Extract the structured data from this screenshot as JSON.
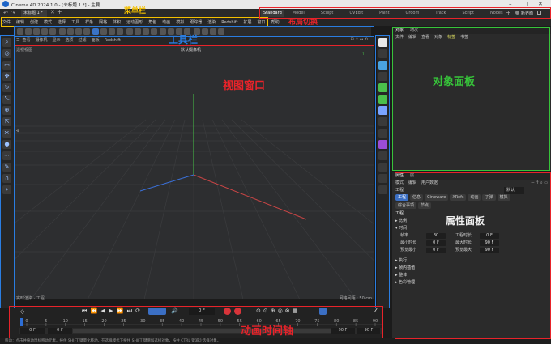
{
  "window": {
    "title": "Cinema 4D 2024.1.0 - [未标题 1 *] - 主要"
  },
  "doc_tab": {
    "label": "未标题 1 *"
  },
  "layout_tabs": [
    "Standard",
    "Model",
    "Sculpt",
    "UVEdit",
    "Paint",
    "Groom",
    "Track",
    "Script",
    "Nodes"
  ],
  "layout_new": "新界面",
  "menu": {
    "items": [
      "文件",
      "编辑",
      "创建",
      "模式",
      "选择",
      "工具",
      "样条",
      "网格",
      "体积",
      "运动图形",
      "角色",
      "动画",
      "模拟",
      "跟踪器",
      "渲染",
      "Redshift",
      "扩展",
      "窗口",
      "帮助"
    ]
  },
  "view_menu": {
    "items": [
      "查看",
      "摄像机",
      "显示",
      "选项",
      "过滤",
      "面板",
      "Redshift"
    ]
  },
  "viewport": {
    "label_tl": "透视视图",
    "camera": "默认摄像机",
    "status_left": "实时渲染 · 工程",
    "status_right": "网格间距 : 50 cm"
  },
  "object_panel": {
    "tabs": [
      "对象",
      "场次"
    ],
    "menu": [
      "文件",
      "编辑",
      "查看",
      "对象",
      "标签",
      "书签"
    ]
  },
  "attr_panel": {
    "tabs": [
      "属性",
      "层"
    ],
    "menu": [
      "模式",
      "编辑",
      "用户数据"
    ],
    "dropdown": "默认",
    "title": "工程",
    "buttons": [
      "工程",
      "信息",
      "Cineware",
      "XRefs",
      "动画",
      "子弹",
      "模拟",
      "综合事项",
      "节点"
    ],
    "section_main": "工程",
    "group1": "比例",
    "group2": "时间",
    "fields": [
      {
        "label": "帧率",
        "value": "30",
        "label2": "工程时长",
        "value2": "0 F"
      },
      {
        "label": "最小时长",
        "value": "0 F",
        "label2": "最大时长",
        "value2": "90 F"
      },
      {
        "label": "预览最小",
        "value": "0 F",
        "label2": "预览最大",
        "value2": "90 F"
      }
    ],
    "more_groups": [
      "执行",
      "帧内插值",
      "整体",
      "色彩管理"
    ]
  },
  "timeline": {
    "frame": "0 F",
    "ticks": [
      "0",
      "5",
      "10",
      "15",
      "20",
      "25",
      "30",
      "35",
      "40",
      "45",
      "50",
      "55",
      "60",
      "65",
      "70",
      "75",
      "80",
      "85",
      "90"
    ],
    "start": "0 F",
    "start2": "0 F",
    "end": "90 F",
    "end2": "90 F"
  },
  "statusbar": "移动：点击并拖动鼠标移动元素。按住 SHIFT 键量化移动，在选择模式下按住 SHIFT 键增加选择对象，按住 CTRL 键减少选择对象。",
  "annotations": {
    "menu_bar": "菜单栏",
    "layout_switch": "布局切换",
    "toolbar": "工具栏",
    "viewport": "视图窗口",
    "object_panel": "对象面板",
    "attr_panel": "属性面板",
    "timeline": "动画时间轴"
  },
  "colors": {
    "red": "#e8232a",
    "blue": "#2a7de1",
    "yellow": "#f4c000",
    "green": "#37c43a",
    "accent": "#3b6fc4"
  }
}
